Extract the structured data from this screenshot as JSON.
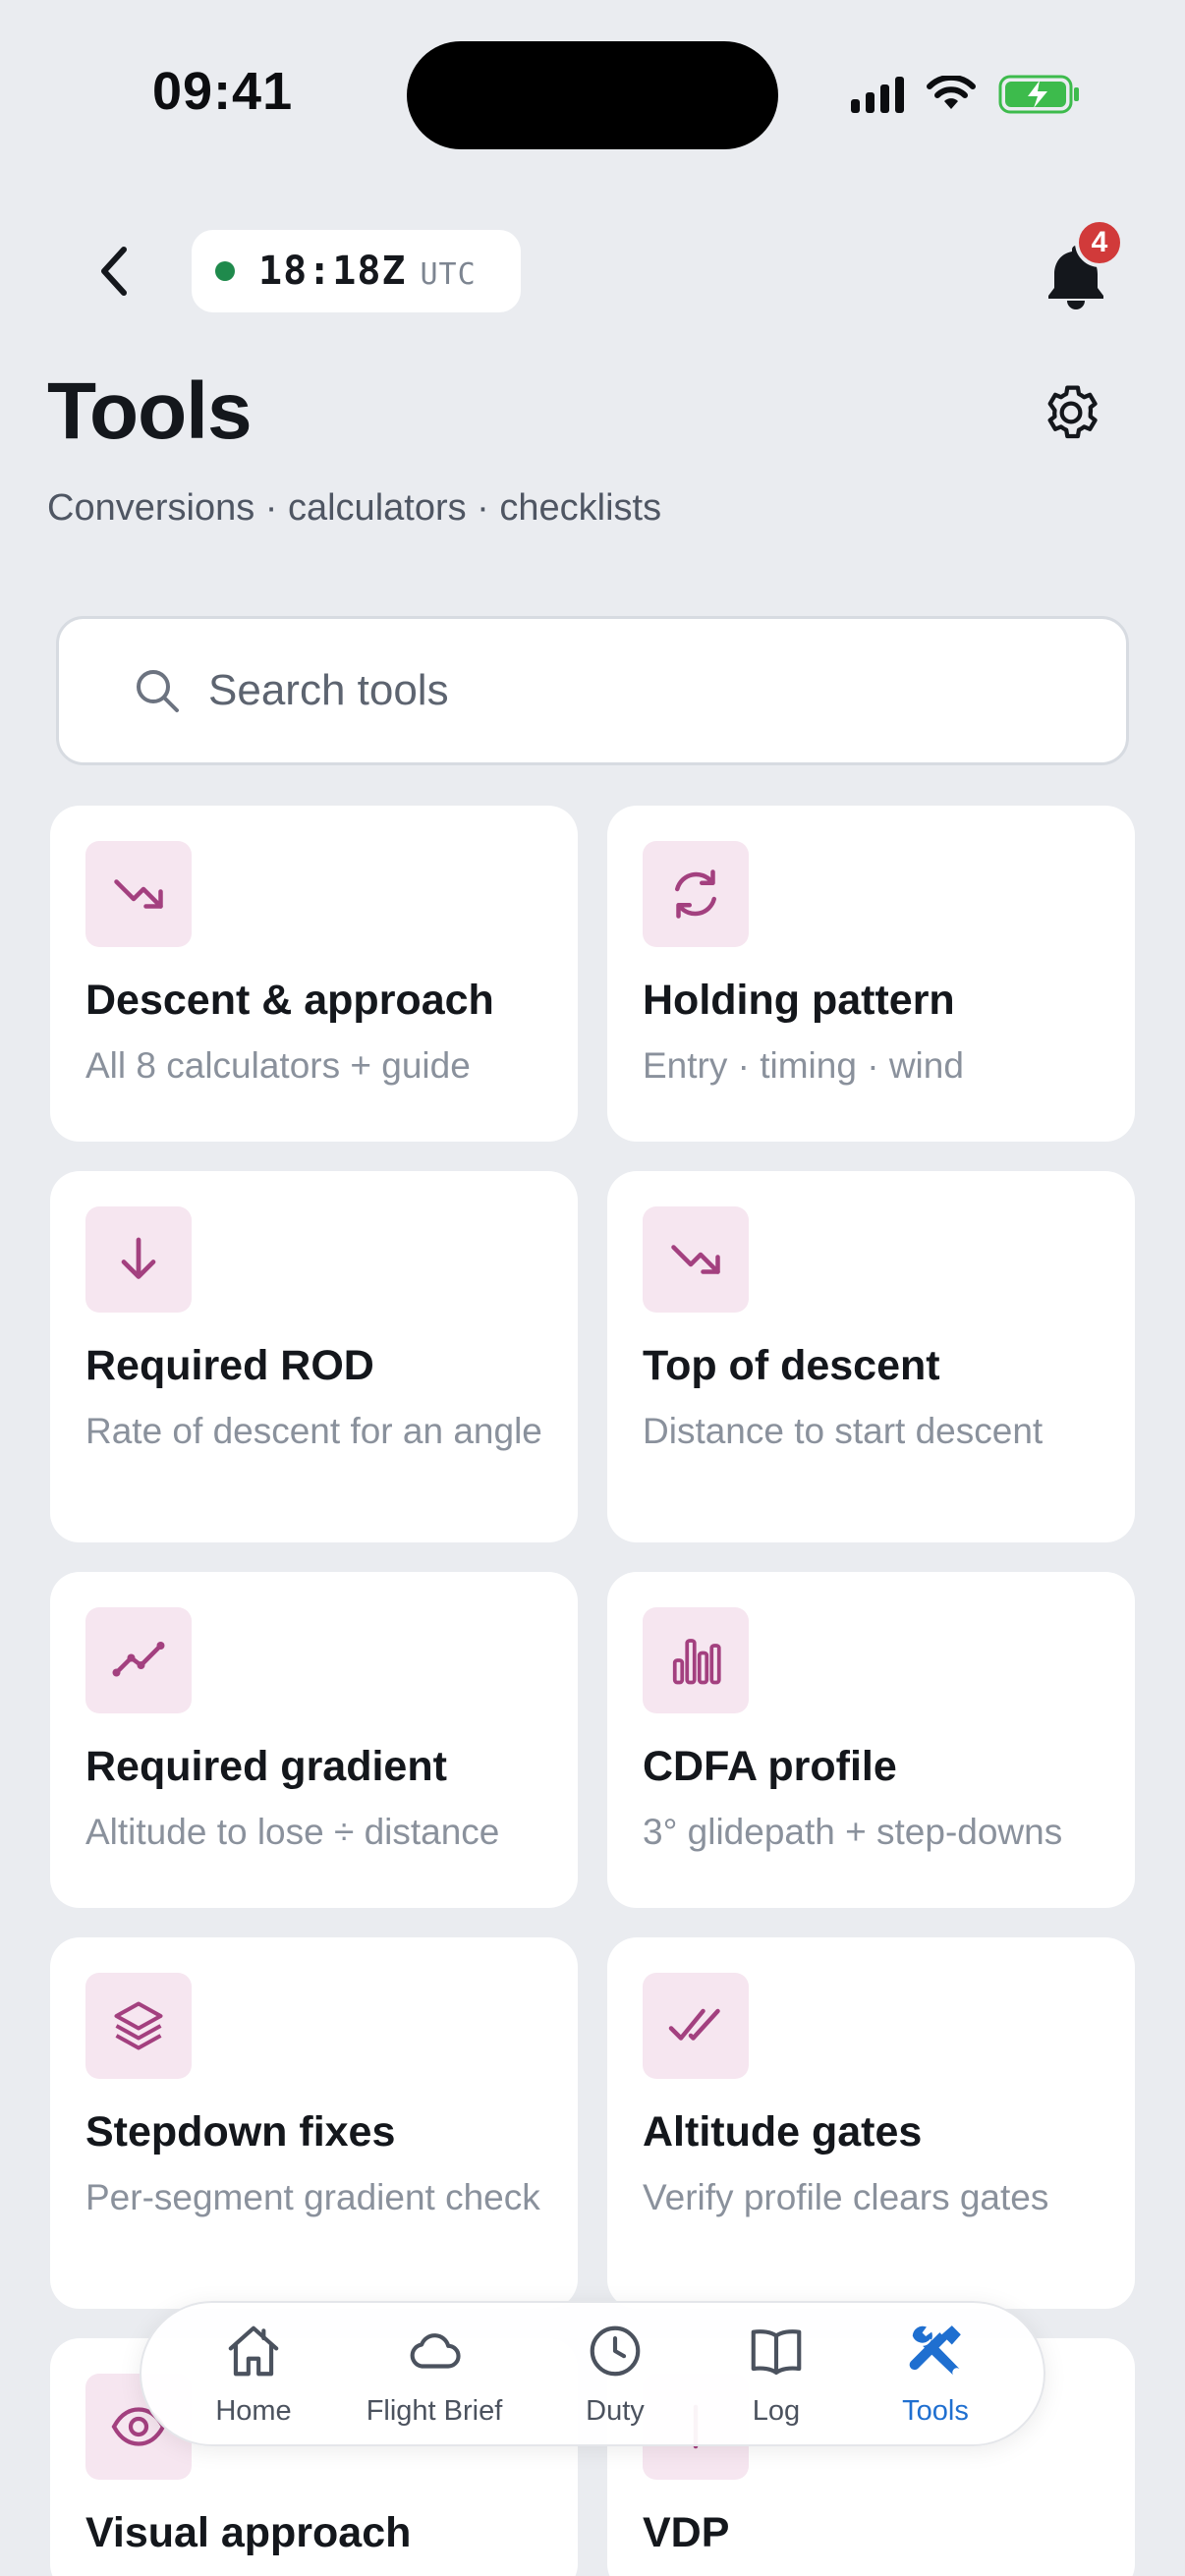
{
  "status_bar": {
    "time": "09:41",
    "icons": [
      "cellular-signal-icon",
      "wifi-icon",
      "battery-charging-icon"
    ]
  },
  "header": {
    "back_icon": "chevron-left-icon",
    "utc_clock": {
      "time": "18:18Z",
      "label": "UTC",
      "status_color": "#1f8a4c"
    },
    "notifications": {
      "icon": "bell-icon",
      "count": "4"
    },
    "settings_icon": "gear-icon"
  },
  "page": {
    "title": "Tools",
    "subtitle": "Conversions · calculators · checklists"
  },
  "search": {
    "placeholder": "Search tools",
    "value": ""
  },
  "tools": [
    {
      "icon": "trending-down-icon",
      "title": "Descent & approach",
      "description": "All 8 calculators + guide"
    },
    {
      "icon": "refresh-cycle-icon",
      "title": "Holding pattern",
      "description": "Entry · timing · wind"
    },
    {
      "icon": "arrow-down-icon",
      "title": "Required ROD",
      "description": "Rate of descent for an angle"
    },
    {
      "icon": "trending-down-icon",
      "title": "Top of descent",
      "description": "Distance to start descent"
    },
    {
      "icon": "trend-line-icon",
      "title": "Required gradient",
      "description": "Altitude to lose ÷ distance"
    },
    {
      "icon": "bar-chart-icon",
      "title": "CDFA profile",
      "description": "3° glidepath + step-downs"
    },
    {
      "icon": "layers-icon",
      "title": "Stepdown fixes",
      "description": "Per-segment gradient check"
    },
    {
      "icon": "double-check-icon",
      "title": "Altitude gates",
      "description": "Verify profile clears gates"
    },
    {
      "icon": "eye-icon",
      "title": "Visual approach",
      "description": ""
    },
    {
      "icon": "vdp-icon",
      "title": "VDP",
      "description": ""
    }
  ],
  "tab_bar": {
    "items": [
      {
        "label": "Home",
        "icon": "home-icon",
        "active": false
      },
      {
        "label": "Flight Brief",
        "icon": "cloud-icon",
        "active": false
      },
      {
        "label": "Duty",
        "icon": "clock-icon",
        "active": false
      },
      {
        "label": "Log",
        "icon": "book-icon",
        "active": false
      },
      {
        "label": "Tools",
        "icon": "tools-icon",
        "active": true
      }
    ]
  },
  "colors": {
    "background": "#eaecf0",
    "accent": "#1f6fd0",
    "icon_tint": "#a3407f",
    "icon_bg": "#f6e6f0",
    "badge": "#d13a3a",
    "online": "#1f8a4c"
  }
}
